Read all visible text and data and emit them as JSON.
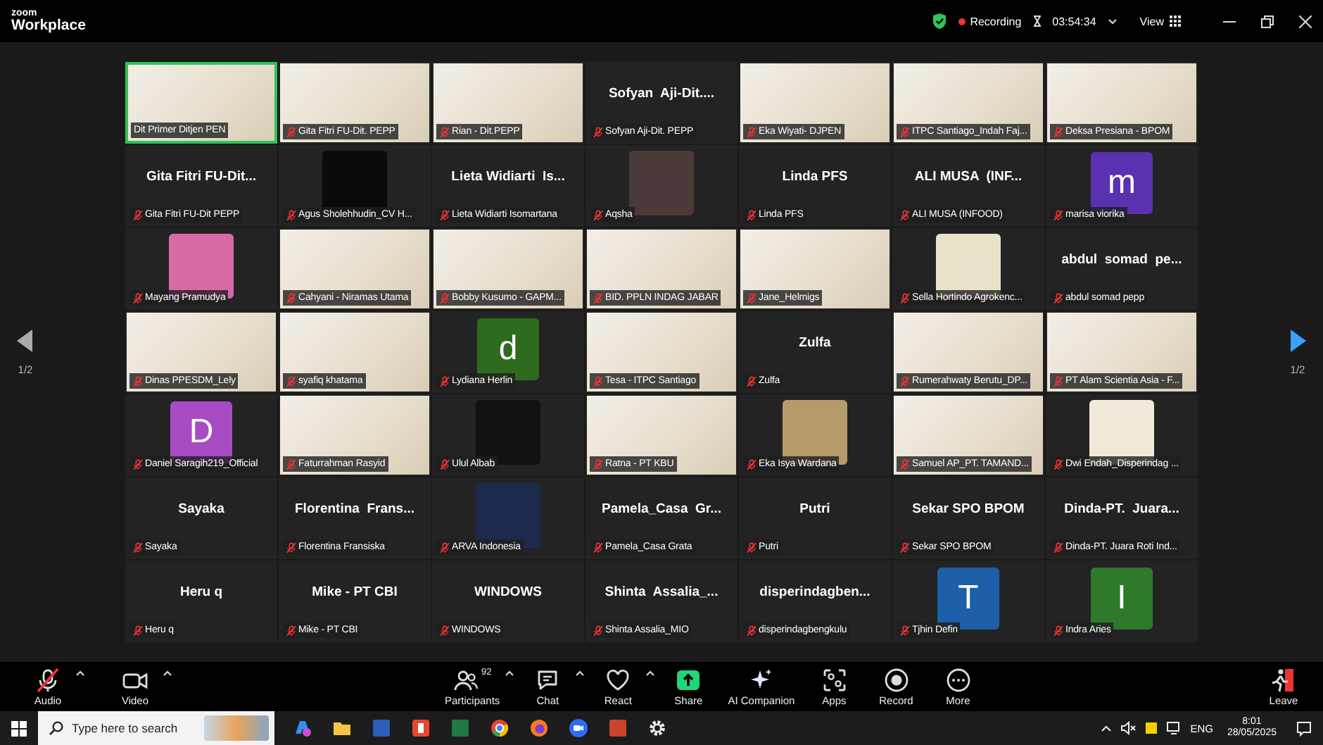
{
  "window": {
    "app_name": "zoom",
    "app_subtitle": "Workplace",
    "recording": true,
    "recording_label": "Recording",
    "timer": "03:54:34",
    "view_label": "View"
  },
  "gallery": {
    "page_left": "1/2",
    "page_right": "1/2",
    "tiles": [
      {
        "kind": "video",
        "label": "Dit Primer Ditjen PEN",
        "muted": false,
        "speaking": true
      },
      {
        "kind": "video",
        "label": "Gita Fitri FU-Dit. PEPP",
        "muted": true,
        "speaking": false
      },
      {
        "kind": "video",
        "label": "Rian - Dit.PEPP",
        "muted": true,
        "speaking": false
      },
      {
        "kind": "name",
        "display_name": "Sofyan  Aji-Dit....",
        "label": "Sofyan Aji-Dit. PEPP",
        "muted": true,
        "speaking": false
      },
      {
        "kind": "video",
        "label": "Eka Wiyati- DJPEN",
        "muted": true,
        "speaking": false
      },
      {
        "kind": "video",
        "label": "ITPC Santiago_Indah Faj...",
        "muted": true,
        "speaking": false
      },
      {
        "kind": "video",
        "label": "Deksa Presiana - BPOM",
        "muted": true,
        "speaking": false
      },
      {
        "kind": "name",
        "display_name": "Gita Fitri FU-Dit...",
        "label": "Gita Fitri FU-Dit PEPP",
        "muted": true,
        "speaking": false
      },
      {
        "kind": "picture",
        "color": "#0a0a0a",
        "label": "Agus Sholehhudin_CV H...",
        "muted": true,
        "speaking": false
      },
      {
        "kind": "name",
        "display_name": "Lieta Widiarti  Is...",
        "label": "Lieta Widiarti Isomartana",
        "muted": true,
        "speaking": false
      },
      {
        "kind": "picture",
        "color": "#4a3a3a",
        "label": "Aqsha",
        "muted": true,
        "speaking": false
      },
      {
        "kind": "name",
        "display_name": "Linda PFS",
        "label": "Linda PFS",
        "muted": true,
        "speaking": false
      },
      {
        "kind": "name",
        "display_name": "ALI MUSA  (INF...",
        "label": "ALI MUSA (INFOOD)",
        "muted": true,
        "speaking": false
      },
      {
        "kind": "avatar",
        "letter": "m",
        "color": "#5a31b0",
        "label": "marisa viorika",
        "muted": true,
        "speaking": false
      },
      {
        "kind": "picture",
        "color": "#d86aa8",
        "label": "Mayang Pramudya",
        "muted": true,
        "speaking": false
      },
      {
        "kind": "video",
        "label": "Cahyani - Niramas Utama",
        "muted": true,
        "speaking": false
      },
      {
        "kind": "video",
        "label": "Bobby Kusumo - GAPM...",
        "muted": true,
        "speaking": false
      },
      {
        "kind": "video",
        "label": "BID. PPLN INDAG JABAR",
        "muted": true,
        "speaking": false
      },
      {
        "kind": "video",
        "label": "Jane_Helmigs",
        "muted": true,
        "speaking": false
      },
      {
        "kind": "picture",
        "color": "#e8e2c8",
        "label": "Sella Hortindo Agrokenc...",
        "muted": true,
        "speaking": false
      },
      {
        "kind": "name",
        "display_name": "abdul  somad  pe...",
        "label": "abdul somad pepp",
        "muted": true,
        "speaking": false
      },
      {
        "kind": "video",
        "label": "Dinas PPESDM_Lely",
        "muted": true,
        "speaking": false
      },
      {
        "kind": "video",
        "label": "syafiq khatama",
        "muted": true,
        "speaking": false
      },
      {
        "kind": "avatar",
        "letter": "d",
        "color": "#2f6b1f",
        "label": "Lydiana Herlin",
        "muted": true,
        "speaking": false
      },
      {
        "kind": "video",
        "label": "Tesa - ITPC Santiago",
        "muted": true,
        "speaking": false
      },
      {
        "kind": "name",
        "display_name": "Zulfa",
        "label": "Zulfa",
        "muted": true,
        "speaking": false
      },
      {
        "kind": "video",
        "label": "Rumerahwaty Berutu_DP...",
        "muted": true,
        "speaking": false
      },
      {
        "kind": "video",
        "label": "PT Alam Scientia Asia - F...",
        "muted": true,
        "speaking": false
      },
      {
        "kind": "avatar",
        "letter": "D",
        "color": "#a84cc4",
        "label": "Daniel Saragih219_Official",
        "muted": true,
        "speaking": false
      },
      {
        "kind": "video",
        "label": "Faturrahman Rasyid",
        "muted": true,
        "speaking": false
      },
      {
        "kind": "picture",
        "color": "#111111",
        "label": "Ulul Albab",
        "muted": true,
        "speaking": false
      },
      {
        "kind": "video",
        "label": "Ratna - PT KBU",
        "muted": true,
        "speaking": false
      },
      {
        "kind": "picture",
        "color": "#b59a6a",
        "label": "Eka Isya Wardana",
        "muted": true,
        "speaking": false
      },
      {
        "kind": "video",
        "label": "Samuel AP_PT. TAMAND...",
        "muted": true,
        "speaking": false
      },
      {
        "kind": "picture",
        "color": "#f2ead8",
        "label": "Dwi Endah_Disperindag ...",
        "muted": true,
        "speaking": false
      },
      {
        "kind": "name",
        "display_name": "Sayaka",
        "label": "Sayaka",
        "muted": true,
        "speaking": false
      },
      {
        "kind": "name",
        "display_name": "Florentina  Frans...",
        "label": "Florentina Fransiska",
        "muted": true,
        "speaking": false
      },
      {
        "kind": "picture",
        "color": "#1c2a4e",
        "label": "ARVA Indonesia",
        "muted": true,
        "speaking": false
      },
      {
        "kind": "name",
        "display_name": "Pamela_Casa  Gr...",
        "label": "Pamela_Casa Grata",
        "muted": true,
        "speaking": false
      },
      {
        "kind": "name",
        "display_name": "Putri",
        "label": "Putri",
        "muted": true,
        "speaking": false
      },
      {
        "kind": "name",
        "display_name": "Sekar SPO BPOM",
        "label": "Sekar SPO BPOM",
        "muted": true,
        "speaking": false
      },
      {
        "kind": "name",
        "display_name": "Dinda-PT.  Juara...",
        "label": "Dinda-PT. Juara Roti Ind...",
        "muted": true,
        "speaking": false
      },
      {
        "kind": "name",
        "display_name": "Heru q",
        "label": "Heru q",
        "muted": true,
        "speaking": false
      },
      {
        "kind": "name",
        "display_name": "Mike - PT CBI",
        "label": "Mike - PT CBI",
        "muted": true,
        "speaking": false
      },
      {
        "kind": "name",
        "display_name": "WINDOWS",
        "label": "WINDOWS",
        "muted": true,
        "speaking": false
      },
      {
        "kind": "name",
        "display_name": "Shinta  Assalia_...",
        "label": "Shinta Assalia_MIO",
        "muted": true,
        "speaking": false
      },
      {
        "kind": "name",
        "display_name": "disperindagben...",
        "label": "disperindagbengkulu",
        "muted": true,
        "speaking": false
      },
      {
        "kind": "avatar",
        "letter": "T",
        "color": "#1d5fa8",
        "label": "Tjhin Defin",
        "muted": true,
        "speaking": false
      },
      {
        "kind": "avatar",
        "letter": "I",
        "color": "#2e7a2a",
        "label": "Indra Aries",
        "muted": true,
        "speaking": false
      }
    ]
  },
  "toolbar": {
    "items": [
      {
        "kind": "audio",
        "label": "Audio",
        "muted": true,
        "has_menu": true
      },
      {
        "kind": "video",
        "label": "Video",
        "has_menu": true
      },
      {
        "kind": "participants",
        "label": "Participants",
        "count": "92",
        "has_menu": true
      },
      {
        "kind": "chat",
        "label": "Chat",
        "has_menu": true
      },
      {
        "kind": "react",
        "label": "React",
        "has_menu": true
      },
      {
        "kind": "share",
        "label": "Share",
        "has_menu": false
      },
      {
        "kind": "ai",
        "label": "AI Companion",
        "has_menu": false
      },
      {
        "kind": "apps",
        "label": "Apps",
        "has_menu": false
      },
      {
        "kind": "record",
        "label": "Record",
        "has_menu": false
      },
      {
        "kind": "more",
        "label": "More",
        "has_menu": false
      },
      {
        "kind": "leave",
        "label": "Leave",
        "has_menu": false
      }
    ]
  },
  "taskbar": {
    "search_placeholder": "Type here to search",
    "language": "ENG",
    "time": "8:01",
    "date": "28/05/2025"
  }
}
